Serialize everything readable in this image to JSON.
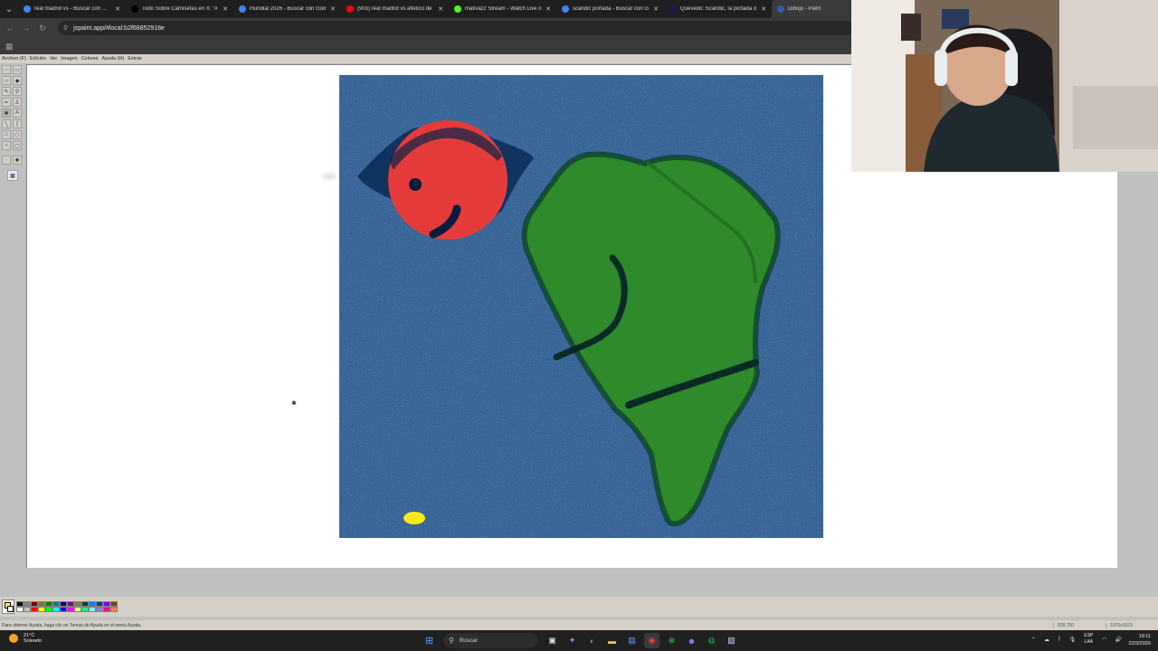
{
  "browser": {
    "tabs": [
      {
        "title": "real madrid vs - Buscar con Goo",
        "color": "#4285f4",
        "active": false
      },
      {
        "title": "Todo Sobre Camisetas en X: \"#",
        "color": "#000000",
        "active": false
      },
      {
        "title": "mundial 2026 - Buscar con Goo",
        "color": "#4285f4",
        "active": false
      },
      {
        "title": "(903) real madrid vs atletico de",
        "color": "#ff0000",
        "active": false
      },
      {
        "title": "mativazz Stream - Watch Live o",
        "color": "#53fc18",
        "active": false
      },
      {
        "title": "scandic portada - Buscar con G",
        "color": "#4285f4",
        "active": false
      },
      {
        "title": "Quevedo: Scandic, la portada d",
        "color": "#1a1a5a",
        "active": false
      },
      {
        "title": "Dibujo - Paint",
        "color": "#2d5fa8",
        "active": true
      }
    ],
    "close_glyph": "✕",
    "url": "jspaint.app/#local:b2f68852918e"
  },
  "paint": {
    "menu": [
      "Archivo (F)",
      "Edición",
      "Ver",
      "Imagen",
      "Colores",
      "Ayuda (H)",
      "Extras"
    ],
    "palette": [
      "#000000",
      "#808080",
      "#800000",
      "#808000",
      "#008000",
      "#008080",
      "#000080",
      "#800080",
      "#808040",
      "#004040",
      "#0080ff",
      "#004080",
      "#8000ff",
      "#804000",
      "#ffffff",
      "#c0c0c0",
      "#ff0000",
      "#ffff00",
      "#00ff00",
      "#00ffff",
      "#0000ff",
      "#ff00ff",
      "#ffff80",
      "#00ff80",
      "#80ffff",
      "#8080ff",
      "#ff0080",
      "#ff8040"
    ],
    "foreground_color": "#ffff66",
    "background_color": "#ffffff",
    "status_help": "Para obtener Ayuda, haga clic en Temas de Ayuda en el menú Ayuda.",
    "cursor_pos": "528,750",
    "canvas_size": "1070x1023"
  },
  "taskbar": {
    "weather_temp": "21°C",
    "weather_desc": "Soleado",
    "search_placeholder": "Buscar",
    "lang_top": "ESP",
    "lang_bottom": "LAA",
    "time": "19:11",
    "date": "22/3/2026"
  }
}
